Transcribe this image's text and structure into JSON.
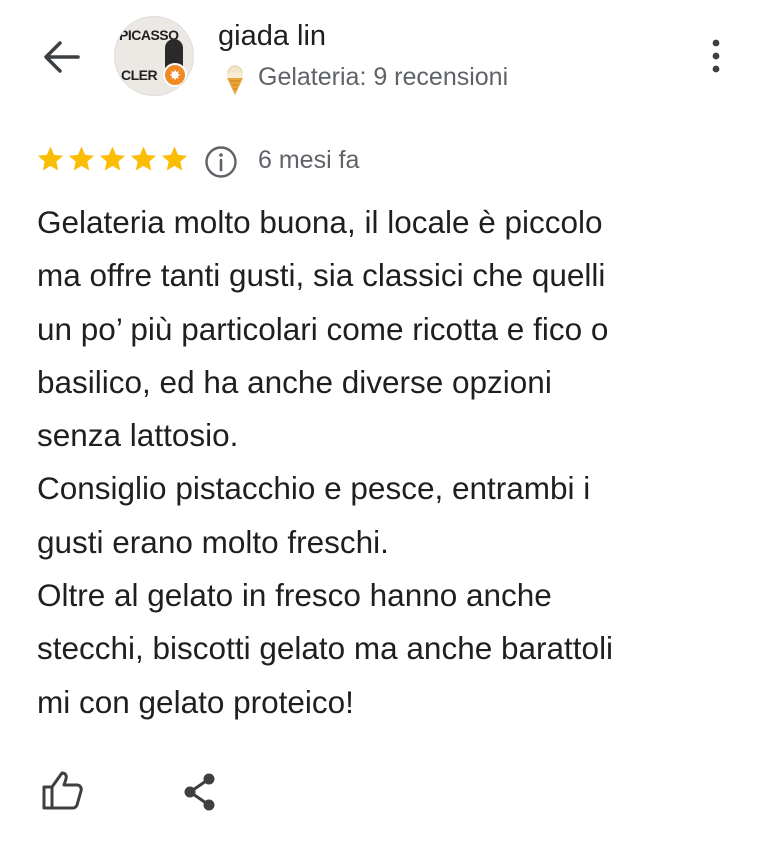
{
  "header": {
    "back_icon": "arrow-back-icon",
    "avatar": {
      "line1": "PICASSO",
      "line2": "CLER",
      "badge_icon": "local-guide-star-icon"
    },
    "reviewer_name": "giada lin",
    "category_icon": "ice-cream-icon",
    "category_text": "Gelateria: 9 recensioni",
    "menu_icon": "more-vert-icon"
  },
  "review": {
    "rating": 5,
    "max_rating": 5,
    "star_color": "#fbbc04",
    "info_icon": "info-icon",
    "time_ago": "6 mesi fa",
    "text": "Gelateria molto buona, il locale è piccolo\nma offre tanti gusti, sia classici che quelli\nun po’ più particolari come ricotta e fico o\nbasilico, ed ha anche diverse opzioni\nsenza lattosio.\nConsiglio pistacchio e pesce, entrambi i\ngusti erano molto freschi.\nOltre al gelato in fresco hanno anche\nstecchi, biscotti gelato ma anche barattoli\nmi con gelato proteico!"
  },
  "actions": {
    "like_icon": "thumb-up-icon",
    "share_icon": "share-icon"
  }
}
